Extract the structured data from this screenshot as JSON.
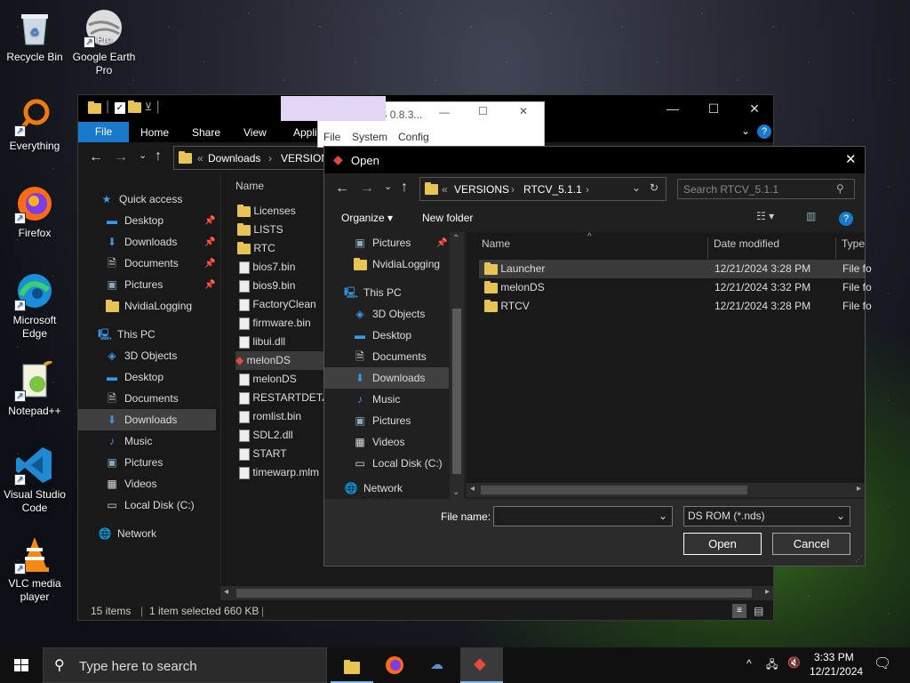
{
  "desktop": {
    "icons": [
      {
        "label": "Recycle Bin",
        "icon": "recycle-bin-icon"
      },
      {
        "label": "Google Earth Pro",
        "icon": "google-earth-icon",
        "badge": "Pro"
      },
      {
        "label": "Everything",
        "icon": "everything-search-icon"
      },
      {
        "label": "Firefox",
        "icon": "firefox-icon"
      },
      {
        "label": "Microsoft Edge",
        "icon": "edge-icon"
      },
      {
        "label": "Notepad++",
        "icon": "notepad-plus-plus-icon"
      },
      {
        "label": "Visual Studio Code",
        "icon": "vscode-icon"
      },
      {
        "label": "VLC media player",
        "icon": "vlc-icon"
      }
    ]
  },
  "explorer": {
    "ribbon_tabs": [
      "File",
      "Home",
      "Share",
      "View",
      "Appli"
    ],
    "address": [
      "Downloads",
      "VERSION"
    ],
    "nav": {
      "quick_access": "Quick access",
      "quick_items": [
        "Desktop",
        "Downloads",
        "Documents",
        "Pictures",
        "NvidiaLogging"
      ],
      "this_pc": "This PC",
      "pc_items": [
        "3D Objects",
        "Desktop",
        "Documents",
        "Downloads",
        "Music",
        "Pictures",
        "Videos",
        "Local Disk (C:)"
      ],
      "network": "Network"
    },
    "column_name": "Name",
    "files": [
      {
        "name": "Licenses",
        "type": "folder"
      },
      {
        "name": "LISTS",
        "type": "folder"
      },
      {
        "name": "RTC",
        "type": "folder"
      },
      {
        "name": "bios7.bin",
        "type": "file"
      },
      {
        "name": "bios9.bin",
        "type": "file"
      },
      {
        "name": "FactoryClean",
        "type": "file"
      },
      {
        "name": "firmware.bin",
        "type": "file"
      },
      {
        "name": "libui.dll",
        "type": "file"
      },
      {
        "name": "melonDS",
        "type": "app"
      },
      {
        "name": "melonDS",
        "type": "file"
      },
      {
        "name": "RESTARTDETA",
        "type": "file"
      },
      {
        "name": "romlist.bin",
        "type": "file"
      },
      {
        "name": "SDL2.dll",
        "type": "file"
      },
      {
        "name": "START",
        "type": "file"
      },
      {
        "name": "timewarp.mlm",
        "type": "file"
      }
    ],
    "status": {
      "items": "15 items",
      "selected": "1 item selected  660 KB"
    }
  },
  "melon": {
    "title": "melonDS 0.8.3...",
    "menu": [
      "File",
      "System",
      "Config"
    ]
  },
  "dialog": {
    "title": "Open",
    "address": [
      "VERSIONS",
      "RTCV_5.1.1"
    ],
    "search_placeholder": "Search RTCV_5.1.1",
    "organize": "Organize ▾",
    "new_folder": "New folder",
    "nav": {
      "items": [
        "Pictures",
        "NvidiaLogging"
      ],
      "this_pc": "This PC",
      "pc_items": [
        "3D Objects",
        "Desktop",
        "Documents",
        "Downloads",
        "Music",
        "Pictures",
        "Videos",
        "Local Disk (C:)"
      ],
      "network": "Network"
    },
    "columns": {
      "name": "Name",
      "date": "Date modified",
      "type": "Type"
    },
    "rows": [
      {
        "name": "Launcher",
        "date": "12/21/2024 3:28 PM",
        "type": "File fo"
      },
      {
        "name": "melonDS",
        "date": "12/21/2024 3:32 PM",
        "type": "File fo"
      },
      {
        "name": "RTCV",
        "date": "12/21/2024 3:28 PM",
        "type": "File fo"
      }
    ],
    "file_name_label": "File name:",
    "file_name_value": "",
    "filter": "DS ROM (*.nds)",
    "open": "Open",
    "cancel": "Cancel"
  },
  "taskbar": {
    "search_placeholder": "Type here to search",
    "time": "3:33 PM",
    "date": "12/21/2024"
  }
}
